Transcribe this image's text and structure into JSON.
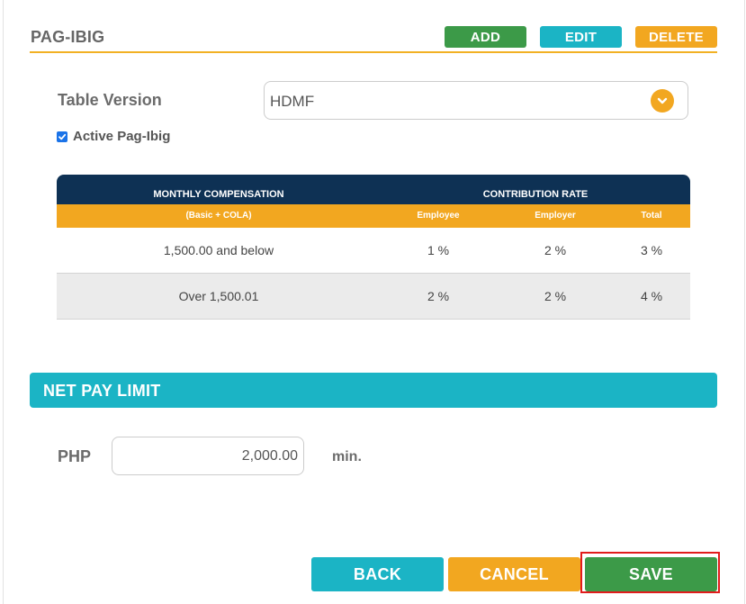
{
  "section": {
    "title": "PAG-IBIG",
    "add_label": "ADD",
    "edit_label": "EDIT",
    "delete_label": "DELETE"
  },
  "table_version": {
    "label": "Table Version",
    "value": "HDMF",
    "icon": "chevron-down-icon"
  },
  "active": {
    "label": "Active Pag-Ibig",
    "checked": true
  },
  "contribution_table": {
    "header_compensation": "MONTHLY COMPENSATION",
    "header_rate": "CONTRIBUTION RATE",
    "sub_compensation": "(Basic + COLA)",
    "sub_employee": "Employee",
    "sub_employer": "Employer",
    "sub_total": "Total",
    "rows": [
      {
        "compensation": "1,500.00 and below",
        "employee": "1 %",
        "employer": "2 %",
        "total": "3 %"
      },
      {
        "compensation": "Over 1,500.01",
        "employee": "2 %",
        "employer": "2 %",
        "total": "4 %"
      }
    ]
  },
  "net_pay_limit": {
    "title": "NET PAY LIMIT",
    "currency": "PHP",
    "amount": "2,000.00",
    "unit": "min."
  },
  "footer": {
    "back_label": "BACK",
    "cancel_label": "CANCEL",
    "save_label": "SAVE"
  },
  "colors": {
    "green": "#3c9a48",
    "teal": "#1bb4c5",
    "orange": "#f2a720",
    "navy": "#0e3154",
    "highlight": "#e21c1c"
  }
}
